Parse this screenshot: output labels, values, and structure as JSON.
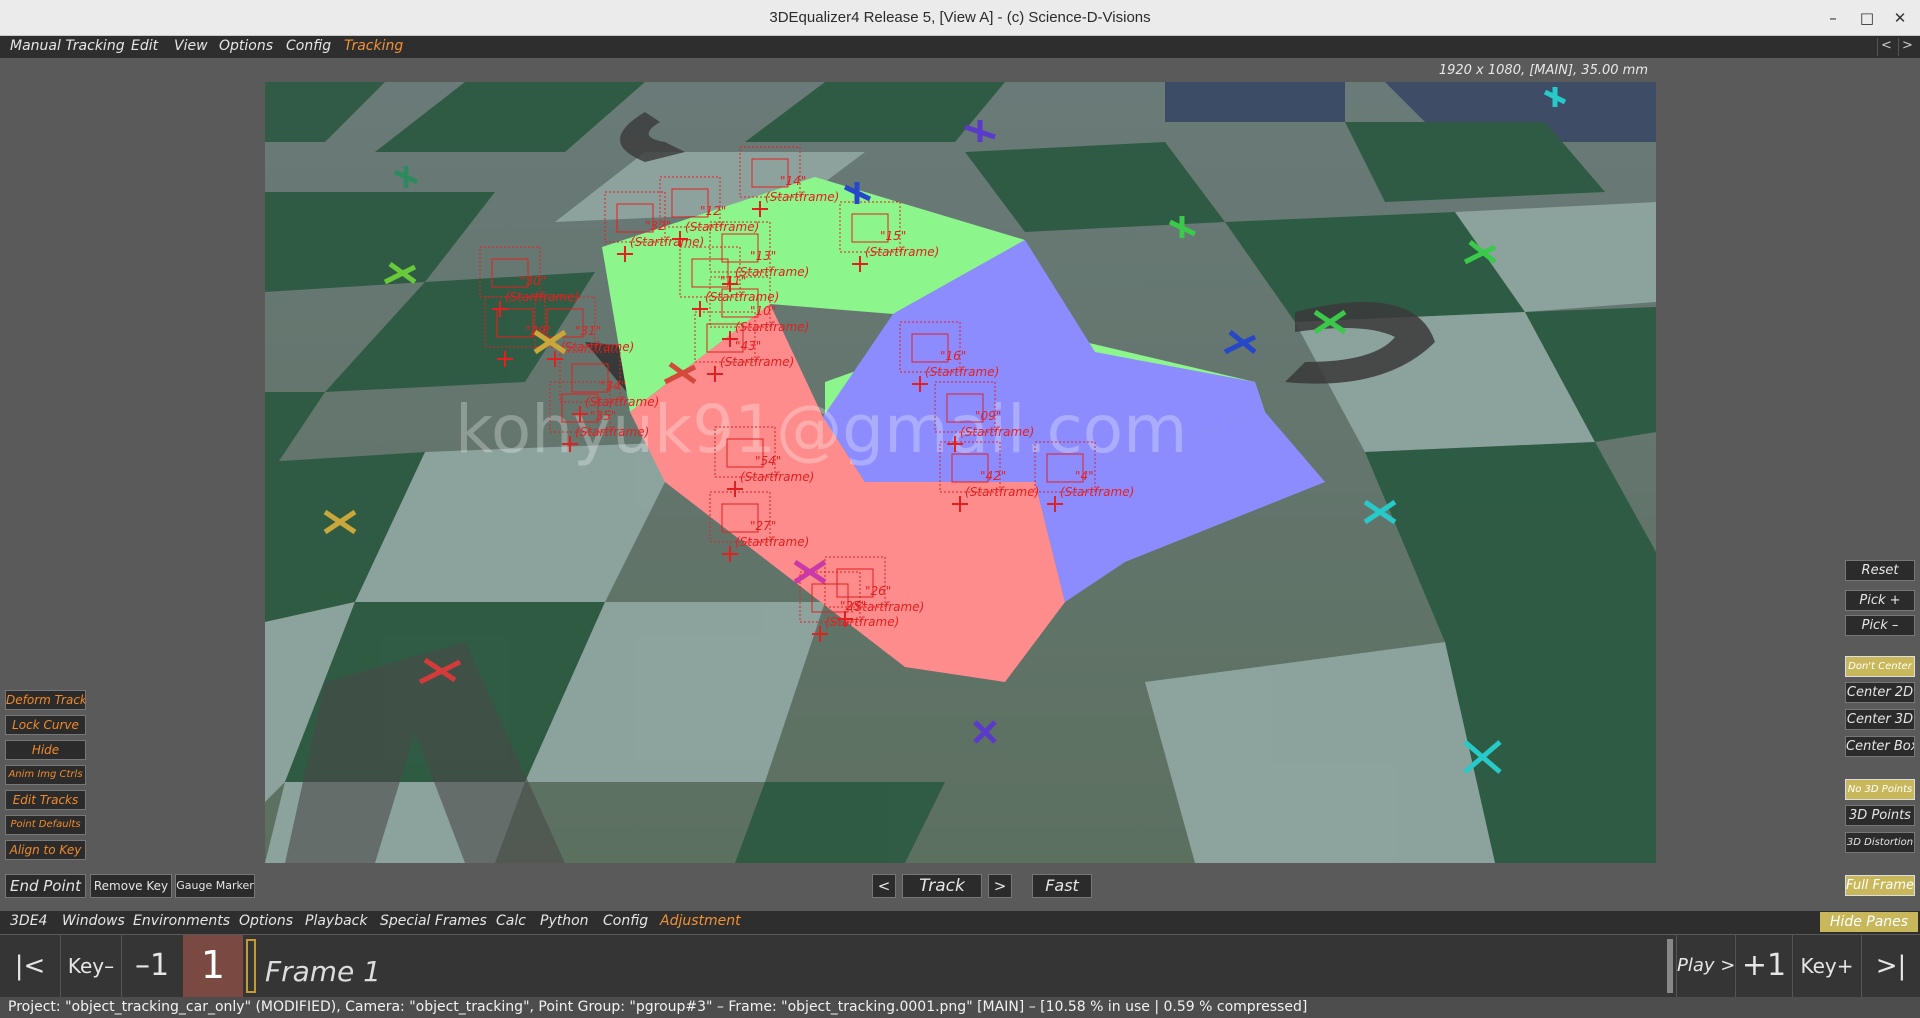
{
  "window": {
    "title": "3DEqualizer4 Release 5, [View A]  -  (c) Science-D-Visions",
    "minimize": "–",
    "maximize": "□",
    "close": "✕"
  },
  "top_menu": {
    "items": [
      "Manual Tracking",
      "Edit",
      "View",
      "Options",
      "Config",
      "Tracking"
    ],
    "active": "Tracking",
    "prev": "<",
    "next": ">"
  },
  "viewport": {
    "resolution_info": "1920 x 1080, [MAIN], 35.00 mm",
    "watermark": "kohyuk91@gmail.com",
    "point_labels": [
      {
        "name": "\"14\"",
        "sub": "(Startframe)"
      },
      {
        "name": "\"15\"",
        "sub": "(Startframe)"
      },
      {
        "name": "\"12\"",
        "sub": "(Startframe)"
      },
      {
        "name": "\"32\"",
        "sub": "(Startframe)"
      },
      {
        "name": "\"13\"",
        "sub": "(Startframe)"
      },
      {
        "name": "\"11\"",
        "sub": "(Startframe)"
      },
      {
        "name": "\"30\"",
        "sub": "(Startframe)"
      },
      {
        "name": "\"10\"",
        "sub": "(Startframe)"
      },
      {
        "name": "\"31\"",
        "sub": "(Startframe)"
      },
      {
        "name": "\"29\"",
        "sub": ""
      },
      {
        "name": "\"43\"",
        "sub": "(Startframe)"
      },
      {
        "name": "\"16\"",
        "sub": "(Startframe)"
      },
      {
        "name": "\"34\"",
        "sub": "(Startframe)"
      },
      {
        "name": "\"35\"",
        "sub": "(Startframe)"
      },
      {
        "name": "\"09\"",
        "sub": "(Startframe)"
      },
      {
        "name": "\"54\"",
        "sub": "(Startframe)"
      },
      {
        "name": "\"42\"",
        "sub": "(Startframe)"
      },
      {
        "name": "\"4\"",
        "sub": "(Startframe)"
      },
      {
        "name": "\"27\"",
        "sub": "(Startframe)"
      },
      {
        "name": "\"26\"",
        "sub": "(Startframe)"
      },
      {
        "name": "\"25\"",
        "sub": "(Startframe)"
      }
    ]
  },
  "left_panel": {
    "buttons": [
      "Deform Track",
      "Lock Curve",
      "Hide",
      "Anim Img Ctrls",
      "Edit Tracks",
      "Point Defaults",
      "Align to Key"
    ]
  },
  "right_panel": {
    "reset": "Reset",
    "pick_plus": "Pick +",
    "pick_minus": "Pick –",
    "dont_center": "Don't Center",
    "center_2d": "Center 2D",
    "center_3d": "Center 3D",
    "center_box": "Center Box",
    "no_3d_points": "No 3D Points",
    "points_3d": "3D Points",
    "distortion_3d": "3D Distortion",
    "full_frame": "Full Frame"
  },
  "bottom_controls": {
    "end_point": "End Point",
    "remove_key": "Remove Key",
    "gauge_marker": "Gauge Marker",
    "track_prev": "<",
    "track": "Track",
    "track_next": ">",
    "fast": "Fast"
  },
  "bottom_menu": {
    "items": [
      "3DE4",
      "Windows",
      "Environments",
      "Options",
      "Playback",
      "Special Frames",
      "Calc",
      "Python",
      "Config",
      "Adjustment"
    ],
    "active": "Adjustment",
    "hide_panes": "Hide Panes"
  },
  "timeline": {
    "first": "|<",
    "key_minus": "Key–",
    "minus_one": "–1",
    "current_frame": "1",
    "frame_label": "Frame 1",
    "play": "Play >",
    "plus_one": "+1",
    "key_plus": "Key+",
    "last": ">|"
  },
  "status": {
    "text": "Project: \"object_tracking_car_only\"  (MODIFIED), Camera: \"object_tracking\", Point Group: \"pgroup#3\"  –  Frame: \"object_tracking.0001.png\"  [MAIN]  –  [10.58 % in use | 0.59 % compressed]"
  },
  "colors": {
    "accent_orange": "#f08a2e",
    "track_red": "#e32020",
    "box_green": "#8cf58c",
    "box_red": "#ff8c8c",
    "box_blue": "#8c8cff",
    "yellow_button": "#c9b85b"
  }
}
